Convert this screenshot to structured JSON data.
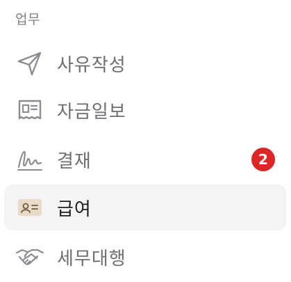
{
  "section": {
    "title": "업무"
  },
  "menu": {
    "items": [
      {
        "label": "사유작성",
        "icon": "send-icon"
      },
      {
        "label": "자금일보",
        "icon": "receipt-icon"
      },
      {
        "label": "결재",
        "icon": "signature-icon",
        "badge": "2"
      },
      {
        "label": "급여",
        "icon": "id-card-icon",
        "active": true
      },
      {
        "label": "세무대행",
        "icon": "handshake-icon"
      }
    ]
  },
  "colors": {
    "badge": "#dc2626",
    "active_bg": "#f3f4f6",
    "icon_gray": "#8b8d92",
    "id_card_bg": "#e8dcc8"
  }
}
